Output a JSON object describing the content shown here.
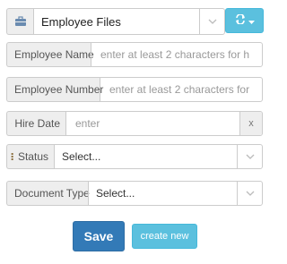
{
  "header": {
    "folder_icon": "briefcase-icon",
    "selected": "Employee Files",
    "refresh_icon": "refresh-icon",
    "dropdown_icon": "caret-down-icon"
  },
  "fields": {
    "employee_name": {
      "label": "Employee Name",
      "placeholder": "enter at least 2 characters for h"
    },
    "employee_number": {
      "label": "Employee Number",
      "placeholder": "enter at least 2 characters for"
    },
    "hire_date": {
      "label": "Hire Date",
      "placeholder": "enter",
      "clear": "x"
    },
    "status": {
      "label": "Status",
      "value": "Select..."
    },
    "document_type": {
      "label": "Document Type",
      "value": "Select..."
    }
  },
  "actions": {
    "save": "Save",
    "create_new": "create new"
  },
  "colors": {
    "primary": "#337ab7",
    "info": "#5bc0de"
  }
}
